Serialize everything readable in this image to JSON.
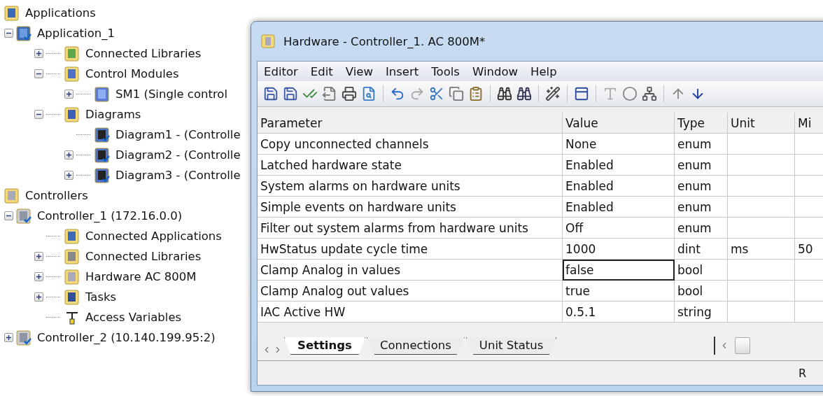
{
  "tree": [
    {
      "label": "Applications",
      "kind": "folder-app",
      "children": [
        {
          "label": "Application_1",
          "kind": "application",
          "expanded": true,
          "children": [
            {
              "label": "Connected Libraries",
              "kind": "library",
              "expanded": false
            },
            {
              "label": "Control Modules",
              "kind": "modules",
              "expanded": true,
              "children": [
                {
                  "label": "SM1  (Single control",
                  "kind": "module",
                  "expanded": false
                }
              ]
            },
            {
              "label": "Diagrams",
              "kind": "diagrams",
              "expanded": true,
              "children": [
                {
                  "label": "Diagram1 - (Controlle",
                  "kind": "diagram"
                },
                {
                  "label": "Diagram2 - (Controlle",
                  "kind": "diagram",
                  "expanded": false
                },
                {
                  "label": "Diagram3 - (Controlle",
                  "kind": "diagram",
                  "expanded": false
                }
              ]
            }
          ]
        }
      ]
    },
    {
      "label": "Controllers",
      "kind": "folder-ctrl",
      "children": [
        {
          "label": "Controller_1 (172.16.0.0)",
          "kind": "controller",
          "expanded": true,
          "children": [
            {
              "label": "Connected Applications",
              "kind": "folder-app"
            },
            {
              "label": "Connected Libraries",
              "kind": "library-grey",
              "expanded": false
            },
            {
              "label": "Hardware  AC 800M",
              "kind": "folder-ctrl",
              "expanded": false
            },
            {
              "label": "Tasks",
              "kind": "tasks",
              "expanded": false
            },
            {
              "label": "Access Variables",
              "kind": "access"
            }
          ]
        },
        {
          "label": "Controller_2 (10.140.199.95:2)",
          "kind": "controller",
          "expanded": false
        }
      ]
    }
  ],
  "window": {
    "title": "Hardware - Controller_1.  AC 800M*",
    "menu": [
      "Editor",
      "Edit",
      "View",
      "Insert",
      "Tools",
      "Window",
      "Help"
    ],
    "table": {
      "columns": [
        "Parameter",
        "Value",
        "Type",
        "Unit",
        "Mi"
      ],
      "rows": [
        {
          "cells": [
            "Copy unconnected channels",
            "None",
            "enum",
            "",
            ""
          ],
          "focused": false
        },
        {
          "cells": [
            "Latched hardware state",
            "Enabled",
            "enum",
            "",
            ""
          ],
          "focused": false
        },
        {
          "cells": [
            "System alarms on hardware units",
            "Enabled",
            "enum",
            "",
            ""
          ],
          "focused": false
        },
        {
          "cells": [
            "Simple events on hardware units",
            "Enabled",
            "enum",
            "",
            ""
          ],
          "focused": false
        },
        {
          "cells": [
            "Filter out system alarms from hardware units",
            "Off",
            "enum",
            "",
            ""
          ],
          "focused": false
        },
        {
          "cells": [
            "HwStatus update cycle time",
            "1000",
            "dint",
            "ms",
            "50"
          ],
          "focused": false
        },
        {
          "cells": [
            "Clamp Analog in values",
            "false",
            "bool",
            "",
            ""
          ],
          "focused": true
        },
        {
          "cells": [
            "Clamp Analog out values",
            "true",
            "bool",
            "",
            ""
          ],
          "focused": false
        },
        {
          "cells": [
            "IAC Active HW",
            "0.5.1",
            "string",
            "",
            ""
          ],
          "focused": false
        }
      ]
    },
    "tabs": [
      {
        "label": "Settings",
        "selected": true
      },
      {
        "label": "Connections",
        "selected": false
      },
      {
        "label": "Unit Status",
        "selected": false
      }
    ],
    "status": "R"
  }
}
